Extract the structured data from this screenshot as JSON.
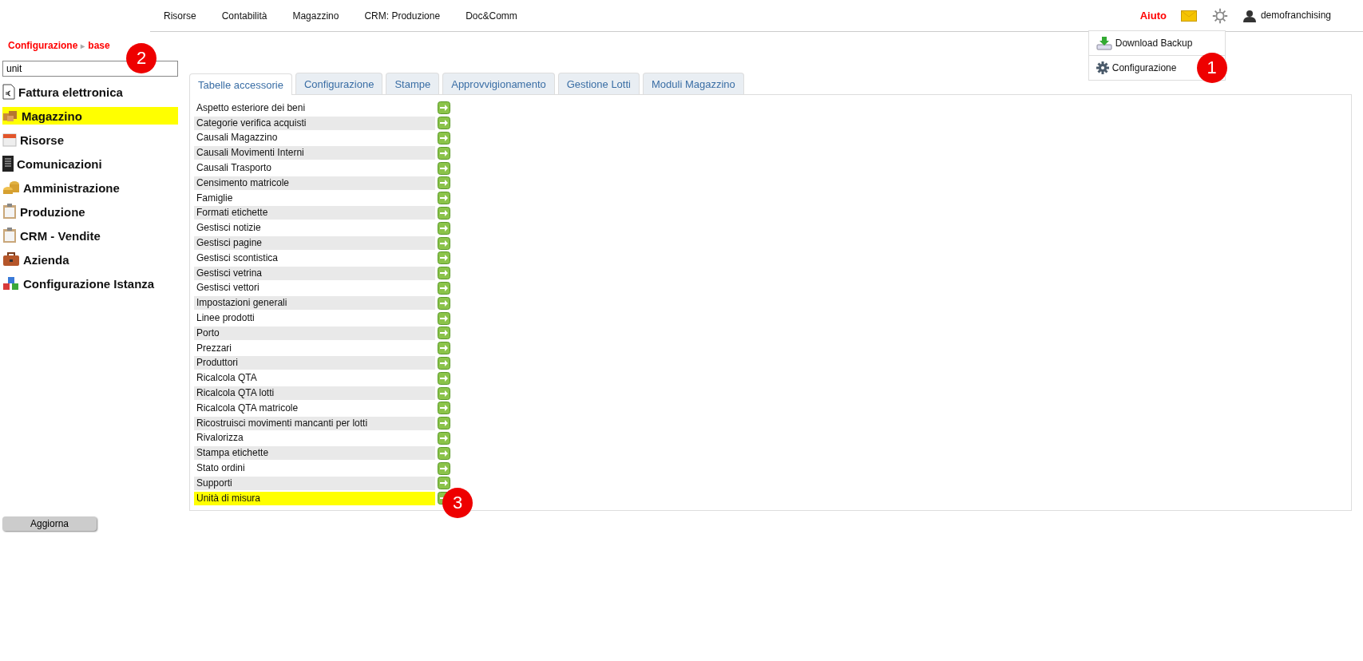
{
  "top_nav": [
    "Risorse",
    "Contabilità",
    "Magazzino",
    "CRM: Produzione",
    "Doc&Comm"
  ],
  "header": {
    "help": "Aiuto",
    "user": "demofranchising"
  },
  "dropdown": [
    {
      "label": "Download Backup",
      "kind": "download"
    },
    {
      "label": "Configurazione",
      "kind": "settings",
      "badge": "1"
    }
  ],
  "breadcrumb": {
    "section": "Configurazione",
    "page": "base",
    "separator": "▸"
  },
  "search": {
    "value": "unit",
    "badge": "2"
  },
  "sidebar": {
    "items": [
      {
        "label": "Fattura elettronica",
        "kind": "invoice",
        "selected": false
      },
      {
        "label": "Magazzino",
        "kind": "warehouse",
        "selected": true
      },
      {
        "label": "Risorse",
        "kind": "resources",
        "selected": false
      },
      {
        "label": "Comunicazioni",
        "kind": "communications",
        "selected": false
      },
      {
        "label": "Amministrazione",
        "kind": "administration",
        "selected": false
      },
      {
        "label": "Produzione",
        "kind": "production",
        "selected": false
      },
      {
        "label": "CRM - Vendite",
        "kind": "production",
        "selected": false
      },
      {
        "label": "Azienda",
        "kind": "company",
        "selected": false
      },
      {
        "label": "Configurazione Istanza",
        "kind": "instance",
        "selected": false
      }
    ],
    "refresh_button": "Aggiorna"
  },
  "tabs": [
    {
      "label": "Tabelle accessorie",
      "selected": true
    },
    {
      "label": "Configurazione",
      "selected": false
    },
    {
      "label": "Stampe",
      "selected": false
    },
    {
      "label": "Approvvigionamento",
      "selected": false
    },
    {
      "label": "Gestione Lotti",
      "selected": false
    },
    {
      "label": "Moduli Magazzino",
      "selected": false
    }
  ],
  "rows": [
    {
      "label": "Aspetto esteriore dei beni",
      "selected": false
    },
    {
      "label": "Categorie verifica acquisti",
      "selected": false
    },
    {
      "label": "Causali Magazzino",
      "selected": false
    },
    {
      "label": "Causali Movimenti Interni",
      "selected": false
    },
    {
      "label": "Causali Trasporto",
      "selected": false
    },
    {
      "label": "Censimento matricole",
      "selected": false
    },
    {
      "label": "Famiglie",
      "selected": false
    },
    {
      "label": "Formati etichette",
      "selected": false
    },
    {
      "label": "Gestisci notizie",
      "selected": false
    },
    {
      "label": "Gestisci pagine",
      "selected": false
    },
    {
      "label": "Gestisci scontistica",
      "selected": false
    },
    {
      "label": "Gestisci vetrina",
      "selected": false
    },
    {
      "label": "Gestisci vettori",
      "selected": false
    },
    {
      "label": "Impostazioni generali",
      "selected": false
    },
    {
      "label": "Linee prodotti",
      "selected": false
    },
    {
      "label": "Porto",
      "selected": false
    },
    {
      "label": "Prezzari",
      "selected": false
    },
    {
      "label": "Produttori",
      "selected": false
    },
    {
      "label": "Ricalcola QTA",
      "selected": false
    },
    {
      "label": "Ricalcola QTA lotti",
      "selected": false
    },
    {
      "label": "Ricalcola QTA matricole",
      "selected": false
    },
    {
      "label": "Ricostruisci movimenti mancanti per lotti",
      "selected": false
    },
    {
      "label": "Rivalorizza",
      "selected": false
    },
    {
      "label": "Stampa etichette",
      "selected": false
    },
    {
      "label": "Stato ordini",
      "selected": false
    },
    {
      "label": "Supporti",
      "selected": false
    },
    {
      "label": "Unità di misura",
      "selected": true,
      "badge": "3"
    }
  ]
}
